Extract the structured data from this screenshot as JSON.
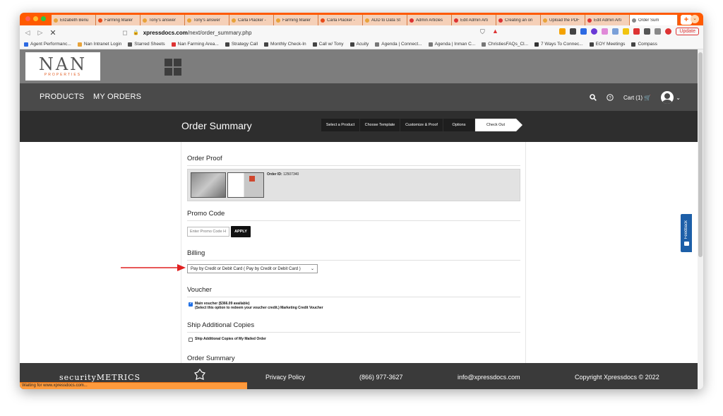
{
  "browser": {
    "tabs": [
      {
        "label": "Elizabeth Benu",
        "color": "#e8a33a"
      },
      {
        "label": "Farming Mailer",
        "color": "#e84a1a"
      },
      {
        "label": "Tony's answer",
        "color": "#e8a33a"
      },
      {
        "label": "Tony's answer",
        "color": "#e8a33a"
      },
      {
        "label": "Carla Placker -",
        "color": "#e8a33a"
      },
      {
        "label": "Farming Mailer",
        "color": "#e8a33a"
      },
      {
        "label": "Carla Placker -",
        "color": "#e84a1a"
      },
      {
        "label": "ADD to Data St",
        "color": "#e8a33a"
      },
      {
        "label": "Admin Articles",
        "color": "#d33"
      },
      {
        "label": "Edit Admin Arti",
        "color": "#d33"
      },
      {
        "label": "Creating an on",
        "color": "#d33"
      },
      {
        "label": "Upload the PDF",
        "color": "#e8a33a"
      },
      {
        "label": "Edit Admin Arti",
        "color": "#d33"
      },
      {
        "label": "Order Sum",
        "color": "#888"
      }
    ],
    "url_prefix": "",
    "url_domain": "xpressdocs.com",
    "url_path": "/next/order_summary.php",
    "update_label": "Update",
    "bookmarks": [
      "Agent Performanc...",
      "Nan Intranet Login",
      "Starred Sheets",
      "Nan Farming Area...",
      "Strategy Call",
      "Monthly Check-In",
      "Call w/ Tony",
      "Acuity",
      "Agenda | Connect...",
      "Agenda | Inman C...",
      "ChristiesFAQs_Cl...",
      "7 Ways To Connec...",
      "EOY Meetings",
      "Compass"
    ],
    "status_text": "Waiting for www.xpressdocs.com..."
  },
  "logo": {
    "letters": "NAN",
    "tagline": "PROPERTIES"
  },
  "nav": {
    "products": "PRODUCTS",
    "my_orders": "MY ORDERS",
    "cart": "Cart (1)"
  },
  "title": {
    "text": "Order Summary"
  },
  "steps": [
    "Select a Product",
    "Choose Template",
    "Customize & Proof",
    "Options",
    "Check Out"
  ],
  "sections": {
    "order_proof": "Order Proof",
    "order_id_label": "Order ID:",
    "order_id_value": "12507340",
    "promo_code": "Promo Code",
    "promo_placeholder": "Enter Promo Code H",
    "apply": "APPLY",
    "billing": "Billing",
    "billing_value": "Pay by Credit or Debit Card ( Pay by Credit or Debit Card )",
    "voucher": "Voucher",
    "voucher_line1": "Main voucher ($366.09 available)",
    "voucher_line2": "(Select this option to redeem your voucher credit.) Marketing Credit Voucher",
    "ship_copies": "Ship Additional Copies",
    "ship_checkbox": "Ship Additional Copies of My Mailed Order",
    "order_summary": "Order Summary"
  },
  "feedback": "Feedback",
  "footer": {
    "security": "securityMETRICS",
    "privacy": "Privacy Policy",
    "phone": "(866) 977-3627",
    "email": "info@xpressdocs.com",
    "copyright": "Copyright Xpressdocs © 2022"
  }
}
